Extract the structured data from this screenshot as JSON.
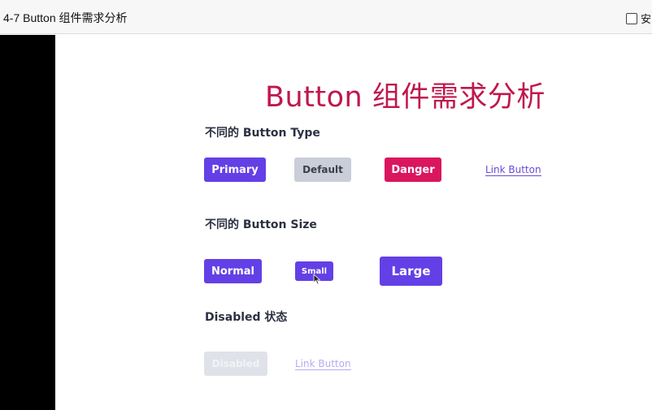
{
  "window": {
    "title": "4-7 Button 组件需求分析",
    "checkbox_label": "安"
  },
  "slide": {
    "title": "Button 组件需求分析",
    "sections": {
      "type": {
        "title": "不同的 Button Type",
        "primary": "Primary",
        "default": "Default",
        "danger": "Danger",
        "link": "Link Button"
      },
      "size": {
        "title": "不同的 Button Size",
        "normal": "Normal",
        "small": "Small",
        "large": "Large"
      },
      "disabled": {
        "title": "Disabled 状态",
        "disabled_btn": "Disabled",
        "link": "Link Button"
      }
    }
  },
  "colors": {
    "title": "#c0174c",
    "primary": "#6340e6",
    "default": "#c9ced8",
    "danger": "#d9165e",
    "link": "#6a49d9"
  },
  "icons": {
    "checkbox": "checkbox-icon",
    "cursor": "mouse-pointer-icon"
  }
}
